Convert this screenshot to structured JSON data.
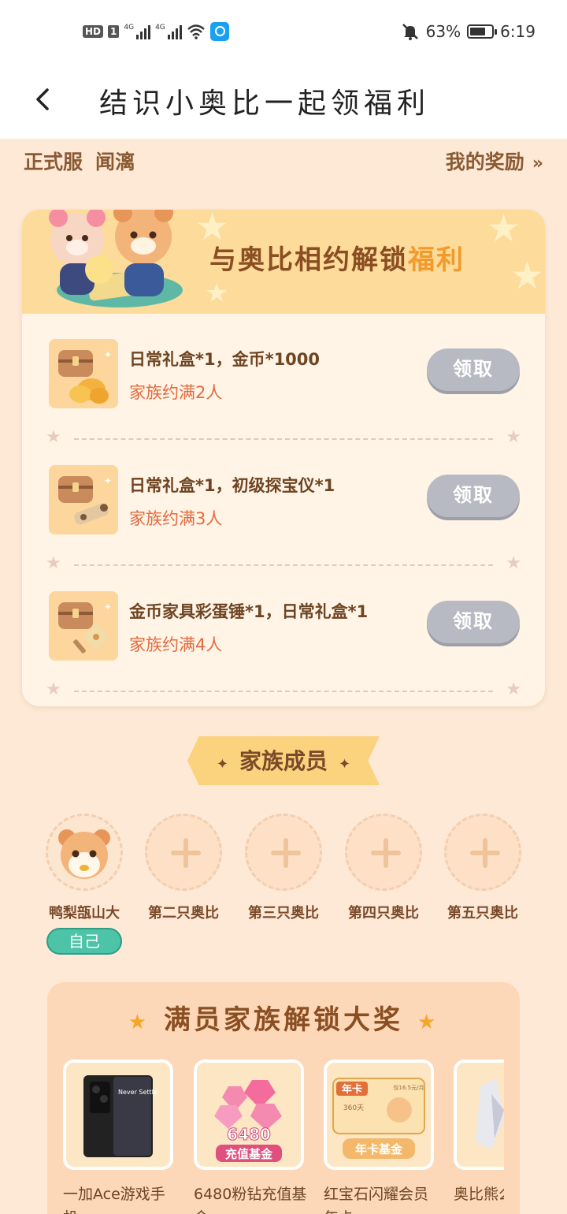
{
  "status_bar": {
    "hd": "HD",
    "sim": "1",
    "signal1": "4G",
    "signal2": "4G",
    "battery": "63%",
    "time": "6:19"
  },
  "header": {
    "title": "结识小奥比一起领福利"
  },
  "top_row": {
    "server": "正式服",
    "player": "闻漓",
    "my_rewards": "我的奖励",
    "chevron": "»"
  },
  "banner": {
    "title_main": "与奥比相约解锁",
    "title_accent": "福利"
  },
  "rewards": [
    {
      "name": "日常礼盒*1，金币*1000",
      "condition": "家族约满2人",
      "button": "领取"
    },
    {
      "name": "日常礼盒*1，初级探宝仪*1",
      "condition": "家族约满3人",
      "button": "领取"
    },
    {
      "name": "金币家具彩蛋锤*1，日常礼盒*1",
      "condition": "家族约满4人",
      "button": "领取"
    }
  ],
  "family": {
    "title": "家族成员",
    "members": [
      {
        "name": "鸭梨瓿山大",
        "badge": "自己"
      },
      {
        "name": "第二只奥比"
      },
      {
        "name": "第三只奥比"
      },
      {
        "name": "第四只奥比"
      },
      {
        "name": "第五只奥比"
      }
    ]
  },
  "grand_prize": {
    "title": "满员家族解锁大奖",
    "prizes": [
      {
        "name": "一加Ace游戏手",
        "name2": "机",
        "img_text": "Never Settle"
      },
      {
        "name": "6480粉钻充值基",
        "name2": "金",
        "img_text": "6480",
        "img_text2": "充值基金"
      },
      {
        "name": "红宝石闪耀会员",
        "name2": "年卡",
        "img_text": "年卡",
        "img_text2": "年卡基金",
        "img_text3": "360天",
        "img_text4": "仅16.5元/月"
      },
      {
        "name": "奥比熊么"
      }
    ]
  },
  "colors": {
    "accent": "#f39a2a",
    "button_disabled": "#b8bac3",
    "condition": "#e36a3e",
    "self_badge": "#4dc3a8"
  }
}
